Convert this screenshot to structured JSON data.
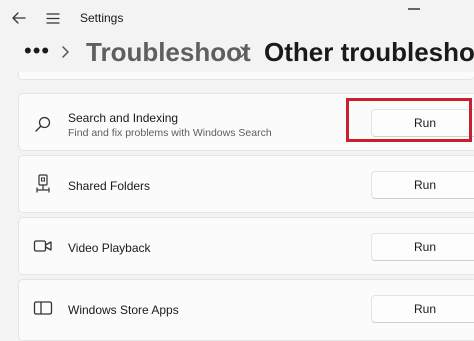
{
  "window": {
    "title": "Settings"
  },
  "breadcrumb": {
    "more": "•••",
    "parent": "Troubleshoot",
    "current": "Other troubleshooters"
  },
  "troubleshooters": [
    {
      "title": "Search and Indexing",
      "subtitle": "Find and fix problems with Windows Search",
      "icon": "search-icon",
      "button": "Run"
    },
    {
      "title": "Shared Folders",
      "subtitle": "",
      "icon": "shared-folder-icon",
      "button": "Run"
    },
    {
      "title": "Video Playback",
      "subtitle": "",
      "icon": "video-camera-icon",
      "button": "Run"
    },
    {
      "title": "Windows Store Apps",
      "subtitle": "",
      "icon": "store-app-icon",
      "button": "Run"
    }
  ],
  "colors": {
    "highlight": "#c8202e",
    "background": "#f3f3f3",
    "card": "#fbfbfb"
  }
}
